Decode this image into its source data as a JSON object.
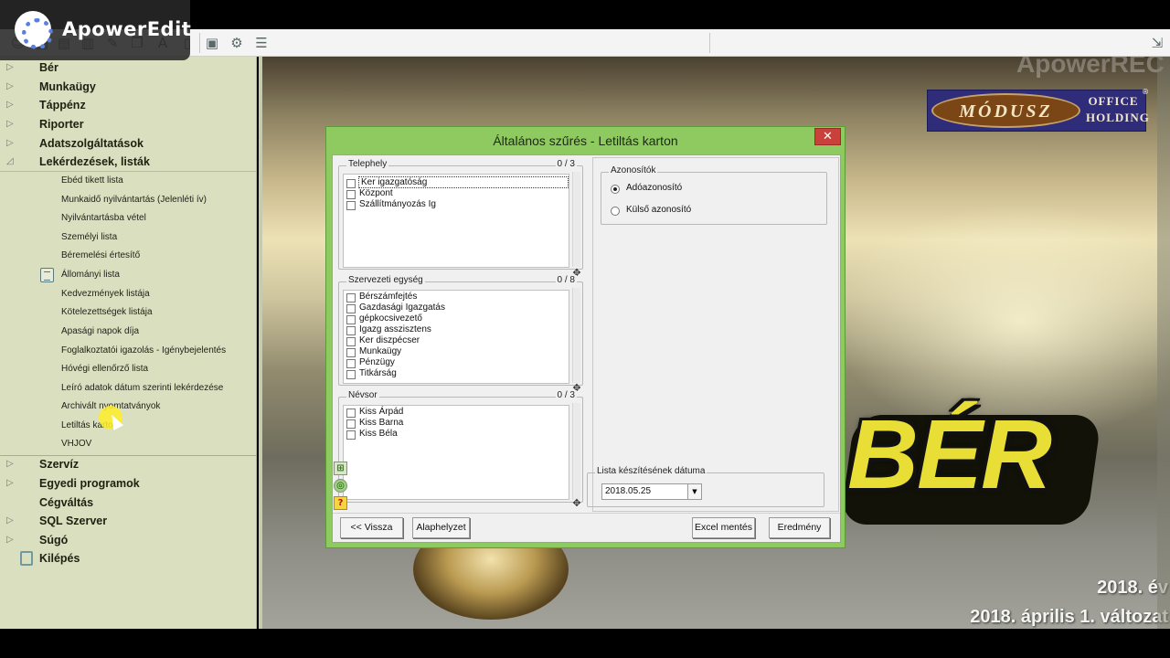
{
  "recorder": {
    "brand": "ApowerEdit",
    "watermark": "ApowerREC"
  },
  "toolbar": {
    "icons": [
      "user-icon",
      "document-icon",
      "document-icon",
      "edit-icon",
      "copy-icon",
      "text-icon",
      "window-icon",
      "save-icon",
      "gear-icon",
      "database-icon",
      "exit-icon"
    ]
  },
  "sidebar": {
    "top_items": [
      {
        "label": "Bér"
      },
      {
        "label": "Munkaügy"
      },
      {
        "label": "Táppénz"
      },
      {
        "label": "Riporter"
      },
      {
        "label": "Adatszolgáltatások"
      },
      {
        "label": "Lekérdezések, listák",
        "expanded": true
      }
    ],
    "sub_items": [
      "Ebéd tikett lista",
      "Munkaidő nyilvántartás (Jelenléti ív)",
      "Nyilvántartásba vétel",
      "Személyi lista",
      "Béremelési értesítő",
      "Állományi lista",
      "Kedvezmények listája",
      "Kötelezettségek listája",
      "Apasági napok díja",
      "Foglalkoztatói igazolás - Igénybejelentés",
      "Hóvégi ellenőrző lista",
      "Leíró adatok dátum szerinti lekérdezése",
      "Archivált nyomtatványok",
      "Letiltás karton",
      "VHJOV"
    ],
    "bottom_items": [
      {
        "label": "Szervíz"
      },
      {
        "label": "Egyedi programok"
      },
      {
        "label": "Cégváltás"
      },
      {
        "label": "SQL Szerver"
      },
      {
        "label": "Súgó"
      },
      {
        "label": "Kilépés"
      }
    ]
  },
  "background": {
    "brand_main": "MÓDUSZ",
    "brand_sub_1": "OFFICE",
    "brand_sub_2": "HOLDING",
    "brand_reg": "®",
    "big_text": "BÉR",
    "year": "2018. év",
    "version": "2018. április 1. változat"
  },
  "dialog": {
    "title": "Általános szűrés - Letiltás karton",
    "close": "✕",
    "telephely": {
      "legend": "Telephely",
      "count": "0 / 3",
      "items": [
        "Ker igazgatóság",
        "Központ",
        "Szállítmányozás Ig"
      ]
    },
    "szervezeti": {
      "legend": "Szervezeti egység",
      "count": "0 / 8",
      "items": [
        "Bérszámfejtés",
        "Gazdasági Igazgatás",
        "gépkocsivezető",
        "Igazg asszisztens",
        "Ker diszpécser",
        "Munkaügy",
        "Pénzügy",
        "Titkárság"
      ]
    },
    "nevsor": {
      "legend": "Névsor",
      "count": "0 / 3",
      "items": [
        "Kiss Árpád",
        "Kiss Barna",
        "Kiss Béla"
      ]
    },
    "azonositok": {
      "legend": "Azonosítók",
      "options": [
        {
          "label": "Adóazonosító",
          "selected": true
        },
        {
          "label": "Külső azonosító",
          "selected": false
        }
      ]
    },
    "datum": {
      "legend": "Lista készítésének dátuma",
      "value": "2018.05.25",
      "arrow": "▼"
    },
    "buttons": {
      "back": "<< Vissza",
      "reset": "Alaphelyzet",
      "excel": "Excel mentés",
      "result": "Eredmény"
    }
  }
}
